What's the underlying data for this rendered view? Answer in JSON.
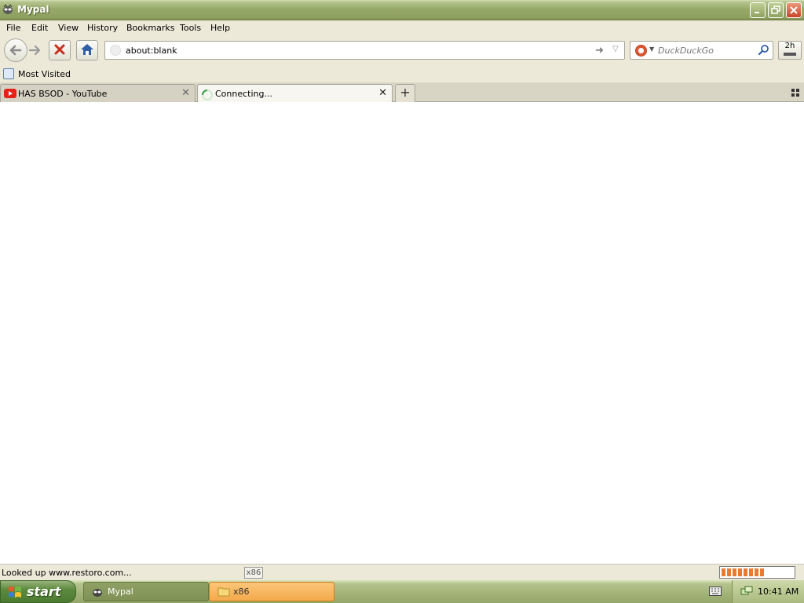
{
  "window": {
    "title": "Mypal"
  },
  "menu": [
    "File",
    "Edit",
    "View",
    "History",
    "Bookmarks",
    "Tools",
    "Help"
  ],
  "nav": {
    "url": "about:blank",
    "search_placeholder": "DuckDuckGo",
    "addon_label": "2h"
  },
  "bookmarks": {
    "most_visited": "Most Visited"
  },
  "tabs": [
    {
      "title": "HAS BSOD - YouTube",
      "favicon": "youtube-icon",
      "active": false
    },
    {
      "title": "Connecting...",
      "favicon": "loading-spinner-icon",
      "active": true
    }
  ],
  "status": {
    "text": "Looked up www.restoro.com...",
    "tooltip": "x86",
    "progress": 0.6
  },
  "taskbar": {
    "start": "start",
    "tasks": [
      {
        "label": "Mypal",
        "icon": "mypal-icon"
      },
      {
        "label": "x86",
        "icon": "folder-icon"
      }
    ],
    "clock": "10:41 AM"
  },
  "colors": {
    "titlebar": "#97a96a",
    "start_button": "#5d8a3f",
    "active_task": "#f3a94a",
    "progress_fill": "#e97a2f"
  }
}
